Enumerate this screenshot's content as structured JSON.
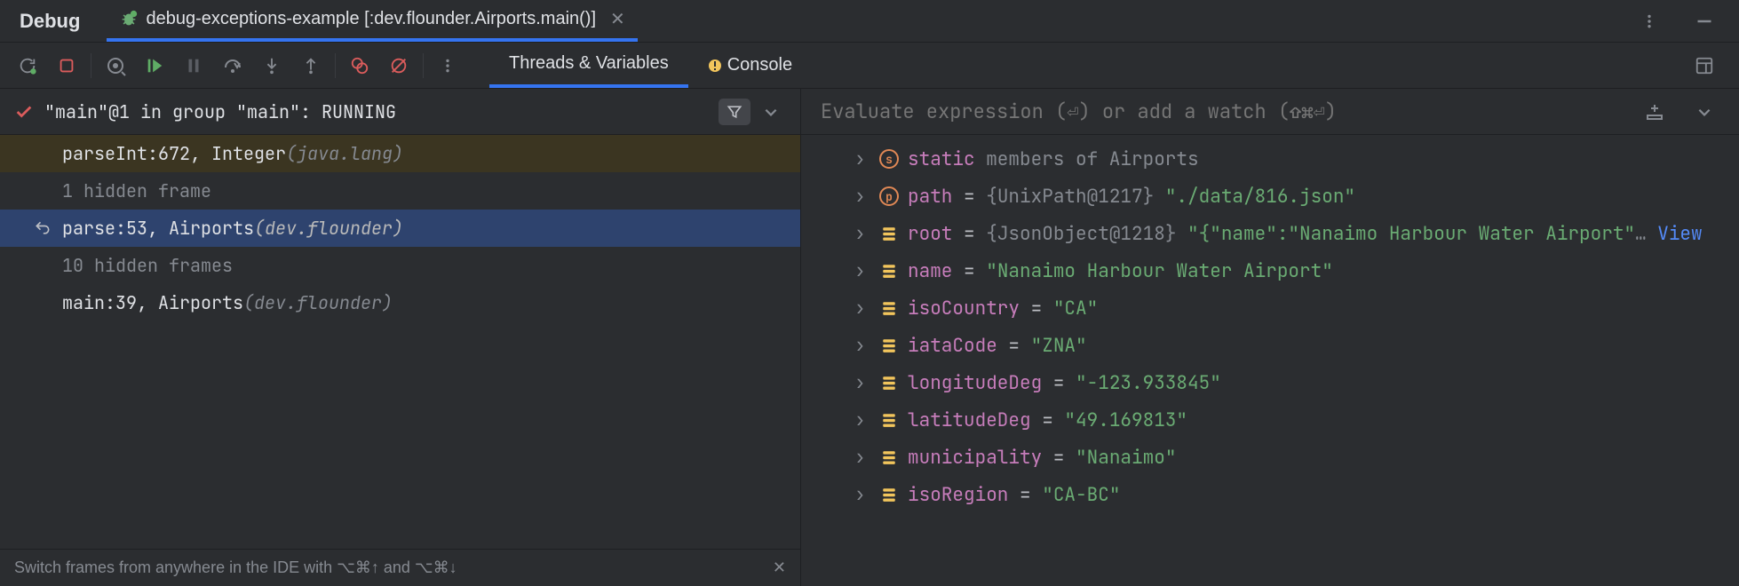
{
  "header": {
    "title": "Debug",
    "run_tab": "debug-exceptions-example [:dev.flounder.Airports.main()]"
  },
  "sub_tabs": {
    "threads": "Threads & Variables",
    "console": "Console"
  },
  "thread_status": "\"main\"@1 in group \"main\": RUNNING",
  "frames": [
    {
      "method": "parseInt:672, Integer ",
      "pkg": "(java.lang)",
      "kind": "library"
    },
    {
      "label": "1 hidden frame",
      "kind": "hidden"
    },
    {
      "method": "parse:53, Airports ",
      "pkg": "(dev.flounder)",
      "kind": "selected"
    },
    {
      "label": "10 hidden frames",
      "kind": "hidden"
    },
    {
      "method": "main:39, Airports ",
      "pkg": "(dev.flounder)",
      "kind": "normal"
    }
  ],
  "tip": "Switch frames from anywhere in the IDE with ⌥⌘↑ and ⌥⌘↓",
  "expr_placeholder": "Evaluate expression (⏎) or add a watch (⇧⌘⏎)",
  "vars": [
    {
      "icon": "s",
      "name": "static",
      "members": " members of Airports"
    },
    {
      "icon": "p",
      "name": "path",
      "eq": " = ",
      "type": "{UnixPath@1217} ",
      "val": "\"./data/816.json\""
    },
    {
      "icon": "f",
      "name": "root",
      "eq": " = ",
      "type": "{JsonObject@1218} ",
      "val": "\"{\"name\":\"Nanaimo Harbour Water Airport\"",
      "more": "… ",
      "view": "View"
    },
    {
      "icon": "f",
      "name": "name",
      "eq": " = ",
      "val": "\"Nanaimo Harbour Water Airport\""
    },
    {
      "icon": "f",
      "name": "isoCountry",
      "eq": " = ",
      "val": "\"CA\""
    },
    {
      "icon": "f",
      "name": "iataCode",
      "eq": " = ",
      "val": "\"ZNA\""
    },
    {
      "icon": "f",
      "name": "longitudeDeg",
      "eq": " = ",
      "val": "\"-123.933845\""
    },
    {
      "icon": "f",
      "name": "latitudeDeg",
      "eq": " = ",
      "val": "\"49.169813\""
    },
    {
      "icon": "f",
      "name": "municipality",
      "eq": " = ",
      "val": "\"Nanaimo\""
    },
    {
      "icon": "f",
      "name": "isoRegion",
      "eq": " = ",
      "val": "\"CA-BC\""
    }
  ]
}
